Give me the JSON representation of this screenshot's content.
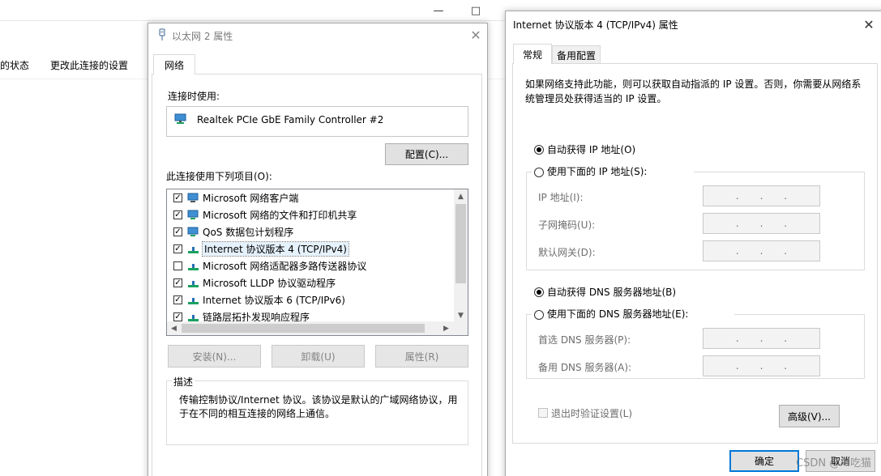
{
  "background_window": {
    "toolbar": [
      "的状态",
      "更改此连接的设置"
    ]
  },
  "ethernet_dialog": {
    "title": "以太网 2 属性",
    "tab": "网络",
    "connect_using_label": "连接时使用:",
    "adapter_name": "Realtek PCIe GbE Family Controller #2",
    "configure_button": "配置(C)...",
    "items_label": "此连接使用下列项目(O):",
    "items": [
      {
        "label": "Microsoft 网络客户端",
        "checked": true
      },
      {
        "label": "Microsoft 网络的文件和打印机共享",
        "checked": true
      },
      {
        "label": "QoS 数据包计划程序",
        "checked": true
      },
      {
        "label": "Internet 协议版本 4 (TCP/IPv4)",
        "checked": true
      },
      {
        "label": "Microsoft 网络适配器多路传送器协议",
        "checked": false
      },
      {
        "label": "Microsoft LLDP 协议驱动程序",
        "checked": true
      },
      {
        "label": "Internet 协议版本 6 (TCP/IPv6)",
        "checked": true
      },
      {
        "label": "链路层拓扑发现响应程序",
        "checked": true
      }
    ],
    "install_button": "安装(N)...",
    "uninstall_button": "卸载(U)",
    "properties_button": "属性(R)",
    "description_legend": "描述",
    "description_text": "传输控制协议/Internet 协议。该协议是默认的广域网络协议，用于在不同的相互连接的网络上通信。"
  },
  "ipv4_dialog": {
    "title": "Internet 协议版本 4 (TCP/IPv4) 属性",
    "tabs": [
      "常规",
      "备用配置"
    ],
    "intro_text": "如果网络支持此功能，则可以获取自动指派的 IP 设置。否则，你需要从网络系统管理员处获得适当的 IP 设置。",
    "auto_ip_radio": "自动获得 IP 地址(O)",
    "manual_ip_radio": "使用下面的 IP 地址(S):",
    "ip_address_label": "IP 地址(I):",
    "subnet_label": "子网掩码(U):",
    "gateway_label": "默认网关(D):",
    "auto_dns_radio": "自动获得 DNS 服务器地址(B)",
    "manual_dns_radio": "使用下面的 DNS 服务器地址(E):",
    "preferred_dns_label": "首选 DNS 服务器(P):",
    "alternate_dns_label": "备用 DNS 服务器(A):",
    "validate_checkbox": "退出时验证设置(L)",
    "advanced_button": "高级(V)...",
    "ok_button": "确定",
    "cancel_button": "取消",
    "selected": {
      "ip_mode": "auto",
      "dns_mode": "auto",
      "validate_on_exit": false
    }
  },
  "watermark": "CSDN @AI吃猫",
  "colors": {
    "accent": "#0078d7",
    "disabled_text": "#838383",
    "border": "#adadad"
  }
}
